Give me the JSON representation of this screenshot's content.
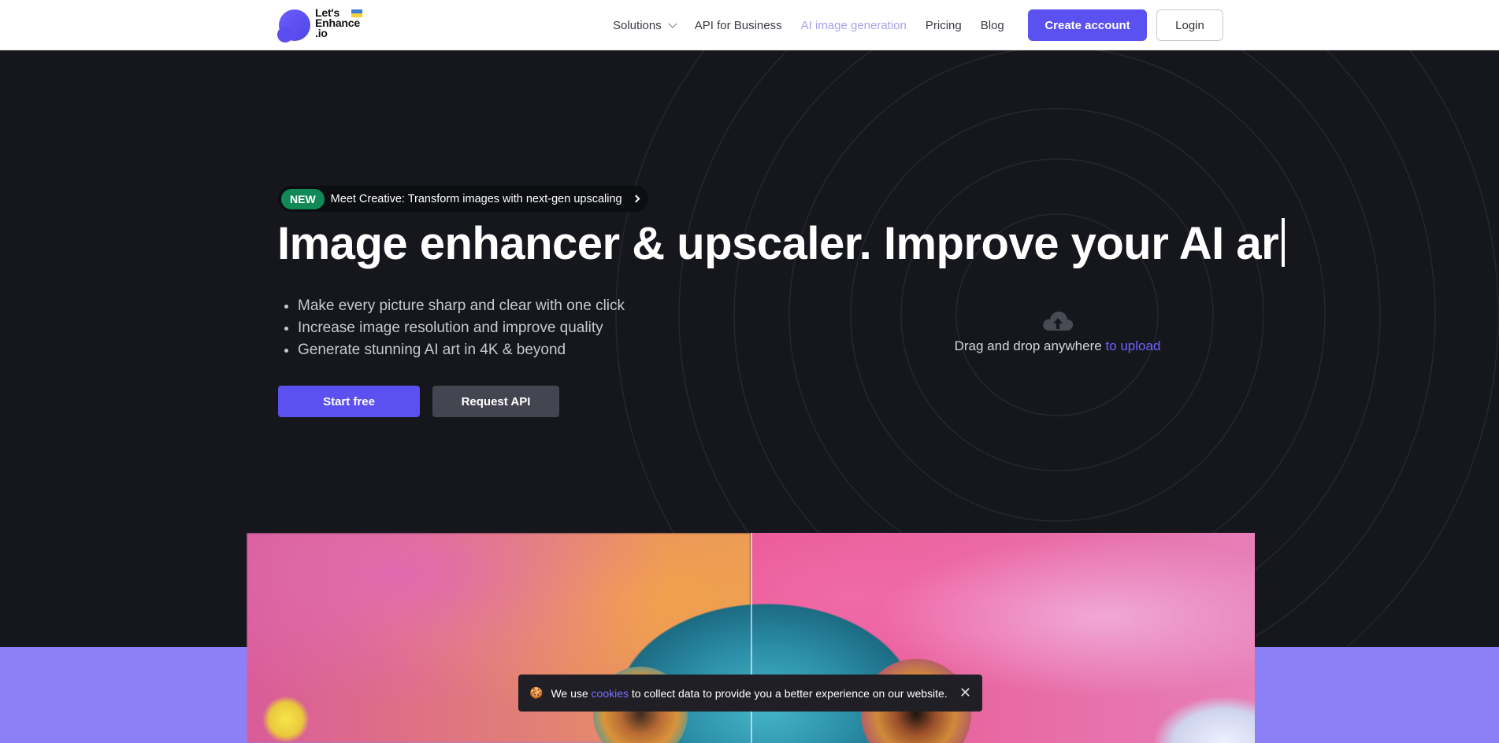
{
  "header": {
    "logo_text": "Let's\nEnhance\n.io",
    "nav": [
      {
        "label": "Solutions",
        "has_dropdown": true
      },
      {
        "label": "API for Business"
      },
      {
        "label": "AI image generation",
        "muted": true
      },
      {
        "label": "Pricing"
      },
      {
        "label": "Blog"
      }
    ],
    "create_account_label": "Create account",
    "login_label": "Login"
  },
  "hero": {
    "news_badge": "NEW",
    "news_text": "Meet Creative: Transform images with next-gen upscaling",
    "headline": "Image enhancer & upscaler.  Improve your AI ar",
    "bullets": [
      "Make every picture sharp and clear with one click",
      "Increase image resolution and improve quality",
      "Generate stunning AI art in 4K & beyond"
    ],
    "start_label": "Start free",
    "api_label": "Request API"
  },
  "upload": {
    "text": "Drag and drop anywhere",
    "link": "to upload"
  },
  "cookie": {
    "prefix": "We use",
    "link": "cookies",
    "suffix": "to collect data to provide you a better experience on our website.",
    "close_symbol": "✕"
  },
  "colors": {
    "accent": "#5b50f0",
    "dark_bg": "#16171c",
    "lavender": "#8b80f5",
    "new_badge": "#118a57",
    "link": "#6c63ff"
  }
}
